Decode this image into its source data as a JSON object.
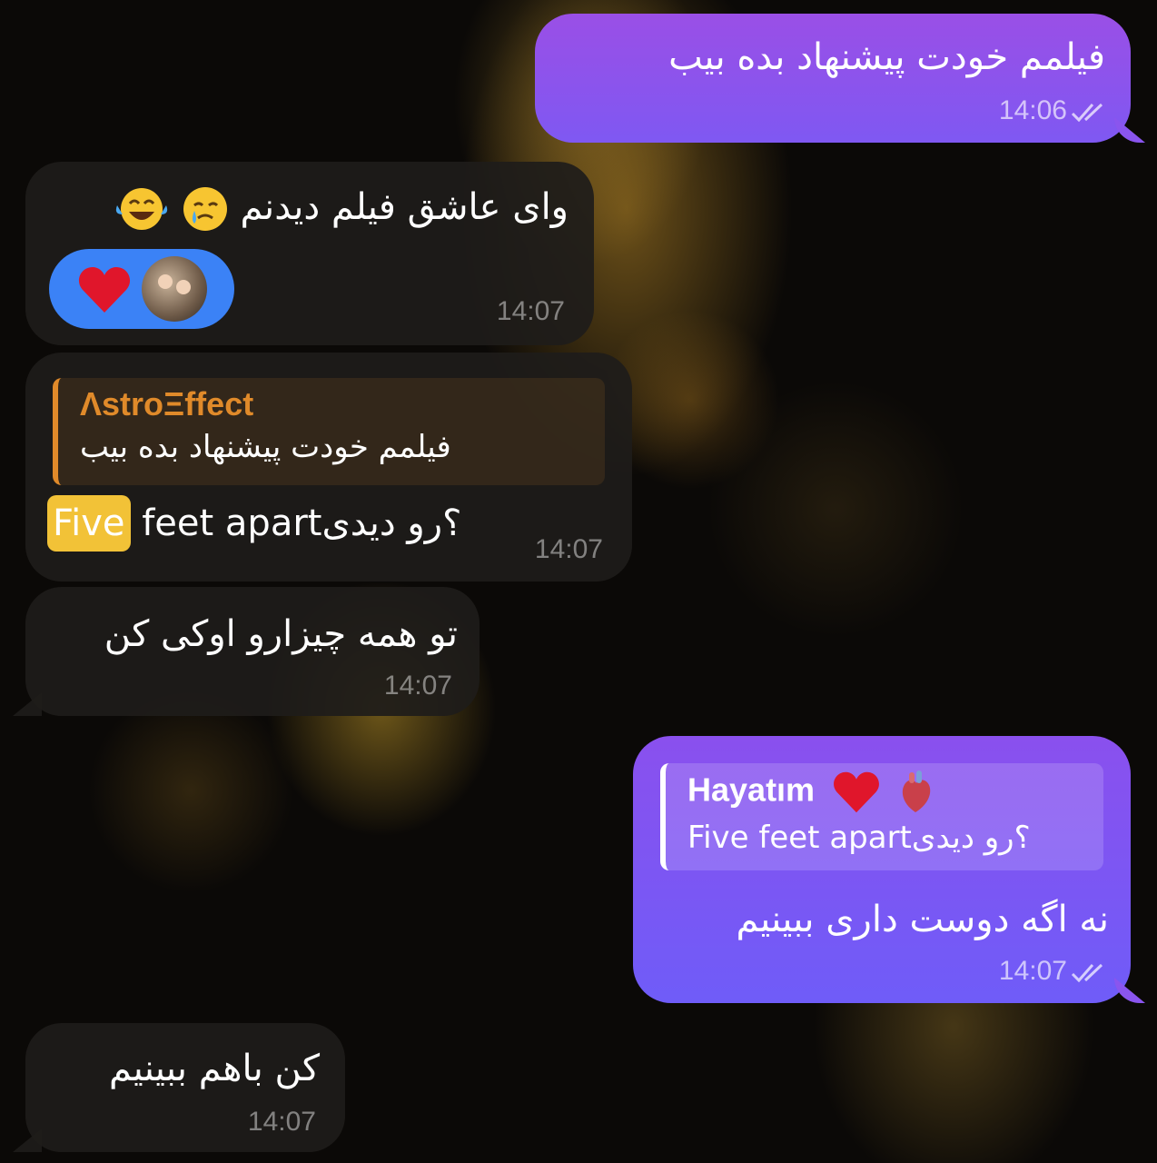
{
  "messages": [
    {
      "id": "m1",
      "direction": "out",
      "text": "فیلمم خودت پیشنهاد بده بیب",
      "time": "14:06",
      "status": "read"
    },
    {
      "id": "m2",
      "direction": "in",
      "text": "وای عاشق فیلم دیدنم",
      "time": "14:07",
      "reaction": {
        "emoji": "heart",
        "has_avatar": true
      }
    },
    {
      "id": "m3",
      "direction": "in",
      "reply_to": {
        "name": "ΛstroΞffect",
        "text": "فیلمم خودت پیشنهاد بده بیب"
      },
      "highlight": "Five",
      "text_rest": " feet apart؟رو دیدی",
      "time": "14:07"
    },
    {
      "id": "m4",
      "direction": "in",
      "text": "تو همه چیزارو اوکی کن",
      "time": "14:07"
    },
    {
      "id": "m5",
      "direction": "out",
      "reply_to": {
        "name": "Hayatım",
        "text": "Five feet apart؟رو دیدی"
      },
      "text": "نه اگه دوست داری ببینیم",
      "time": "14:07",
      "status": "read"
    },
    {
      "id": "m6",
      "direction": "in",
      "text": "کن باهم ببینیم",
      "time": "14:07"
    }
  ],
  "icons": {
    "read_receipt": "double-check-icon",
    "reaction": "heart-icon"
  },
  "colors": {
    "outgoing": "#8a55ee",
    "incoming": "#1e1c1a",
    "reply_accent_in": "#e08a2a",
    "reply_accent_out": "#ffffff",
    "highlight": "#f2c237"
  }
}
